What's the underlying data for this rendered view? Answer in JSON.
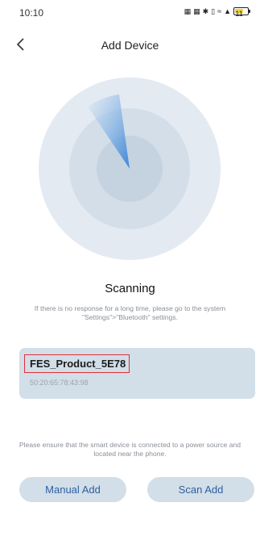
{
  "status_bar": {
    "time": "10:10",
    "icons": [
      "nfc-icon",
      "signal-icon",
      "bluetooth-icon",
      "vibrate-icon",
      "wifi-icon",
      "cellular-icon"
    ],
    "battery_text": "11",
    "battery_level": 0.11
  },
  "header": {
    "title": "Add Device",
    "back_icon": "chevron-left-icon"
  },
  "scan": {
    "title": "Scanning",
    "hint": "If there is no response for a long time, please go to the system \"Settings\">\"Bluetooth\" settings."
  },
  "device": {
    "name": "FES_Product_5E78",
    "mac": "50:20:65:78:43:98"
  },
  "footer": {
    "hint": "Please ensure that the smart device is connected to a power source and located near the phone.",
    "manual_add_label": "Manual Add",
    "scan_add_label": "Scan Add"
  },
  "colors": {
    "radar_outer": "#e3eaf2",
    "radar_mid": "#d3dee9",
    "radar_inner": "#c5d3e0",
    "sweep": "#2e7fd6",
    "card_bg": "#d2dee8",
    "button_text": "#2e5fa0",
    "highlight_border": "#e0303a"
  }
}
